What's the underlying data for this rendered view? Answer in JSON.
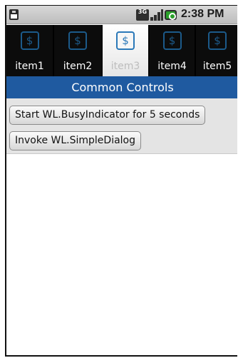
{
  "status_bar": {
    "network_label": "3G",
    "time": "2:38 PM",
    "icons": [
      "sim-card-icon",
      "network-3g-icon",
      "signal-bars-icon",
      "battery-charging-icon"
    ]
  },
  "tabs": [
    {
      "label": "item1",
      "icon": "dollar-icon",
      "selected": false
    },
    {
      "label": "item2",
      "icon": "dollar-icon",
      "selected": false
    },
    {
      "label": "item3",
      "icon": "dollar-icon",
      "selected": true
    },
    {
      "label": "item4",
      "icon": "dollar-icon",
      "selected": false
    },
    {
      "label": "item5",
      "icon": "dollar-icon",
      "selected": false
    }
  ],
  "tab_icon_glyph": "$",
  "header": {
    "title": "Common Controls"
  },
  "buttons": {
    "busy_indicator": "Start WL.BusyIndicator for 5 seconds",
    "simple_dialog": "Invoke WL.SimpleDialog"
  },
  "colors": {
    "header_bg": "#1f5aa0",
    "tab_bar_bg": "#000000",
    "tab_icon": "#1c5a8a",
    "content_bg": "#e4e4e4"
  }
}
